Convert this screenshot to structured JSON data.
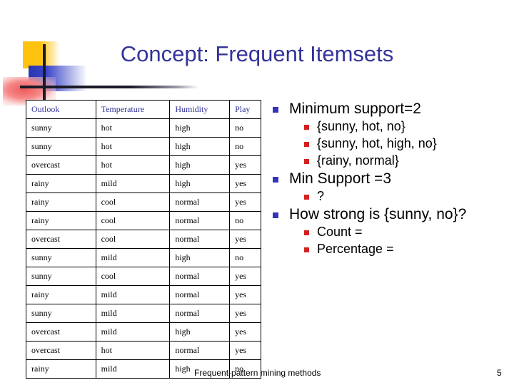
{
  "title": "Concept: Frequent Itemsets",
  "logo": {
    "yellow_hex": "#FFC20E",
    "blue_hex": "#2A35B0",
    "red_hex": "#F05A5A",
    "line_hex": "#1A1A28"
  },
  "colors": {
    "title_hex": "#333399",
    "table_header_hex": "#333399",
    "bullet_level1_hex": "#3333BB",
    "bullet_level2_hex": "#D42020",
    "table_border_hex": "#000000"
  },
  "table": {
    "headers": [
      "Outlook",
      "Temperature",
      "Humidity",
      "Play"
    ],
    "rows": [
      [
        "sunny",
        "hot",
        "high",
        "no"
      ],
      [
        "sunny",
        "hot",
        "high",
        "no"
      ],
      [
        "overcast",
        "hot",
        "high",
        "yes"
      ],
      [
        "rainy",
        "mild",
        "high",
        "yes"
      ],
      [
        "rainy",
        "cool",
        "normal",
        "yes"
      ],
      [
        "rainy",
        "cool",
        "normal",
        "no"
      ],
      [
        "overcast",
        "cool",
        "normal",
        "yes"
      ],
      [
        "sunny",
        "mild",
        "high",
        "no"
      ],
      [
        "sunny",
        "cool",
        "normal",
        "yes"
      ],
      [
        "rainy",
        "mild",
        "normal",
        "yes"
      ],
      [
        "sunny",
        "mild",
        "normal",
        "yes"
      ],
      [
        "overcast",
        "mild",
        "high",
        "yes"
      ],
      [
        "overcast",
        "hot",
        "normal",
        "yes"
      ],
      [
        "rainy",
        "mild",
        "high",
        "no"
      ]
    ]
  },
  "bullets": [
    {
      "level": 1,
      "text": "Minimum support=2"
    },
    {
      "level": 2,
      "text": "{sunny, hot, no}"
    },
    {
      "level": 2,
      "text": "{sunny, hot, high, no}"
    },
    {
      "level": 2,
      "text": "{rainy, normal}"
    },
    {
      "level": 1,
      "text": "Min Support =3"
    },
    {
      "level": 2,
      "text": "?"
    },
    {
      "level": 1,
      "text": "How strong is {sunny, no}?"
    },
    {
      "level": 2,
      "text": "Count ="
    },
    {
      "level": 2,
      "text": "Percentage ="
    }
  ],
  "footer": {
    "text": "Frequent-pattern mining methods",
    "page_number": "5"
  }
}
